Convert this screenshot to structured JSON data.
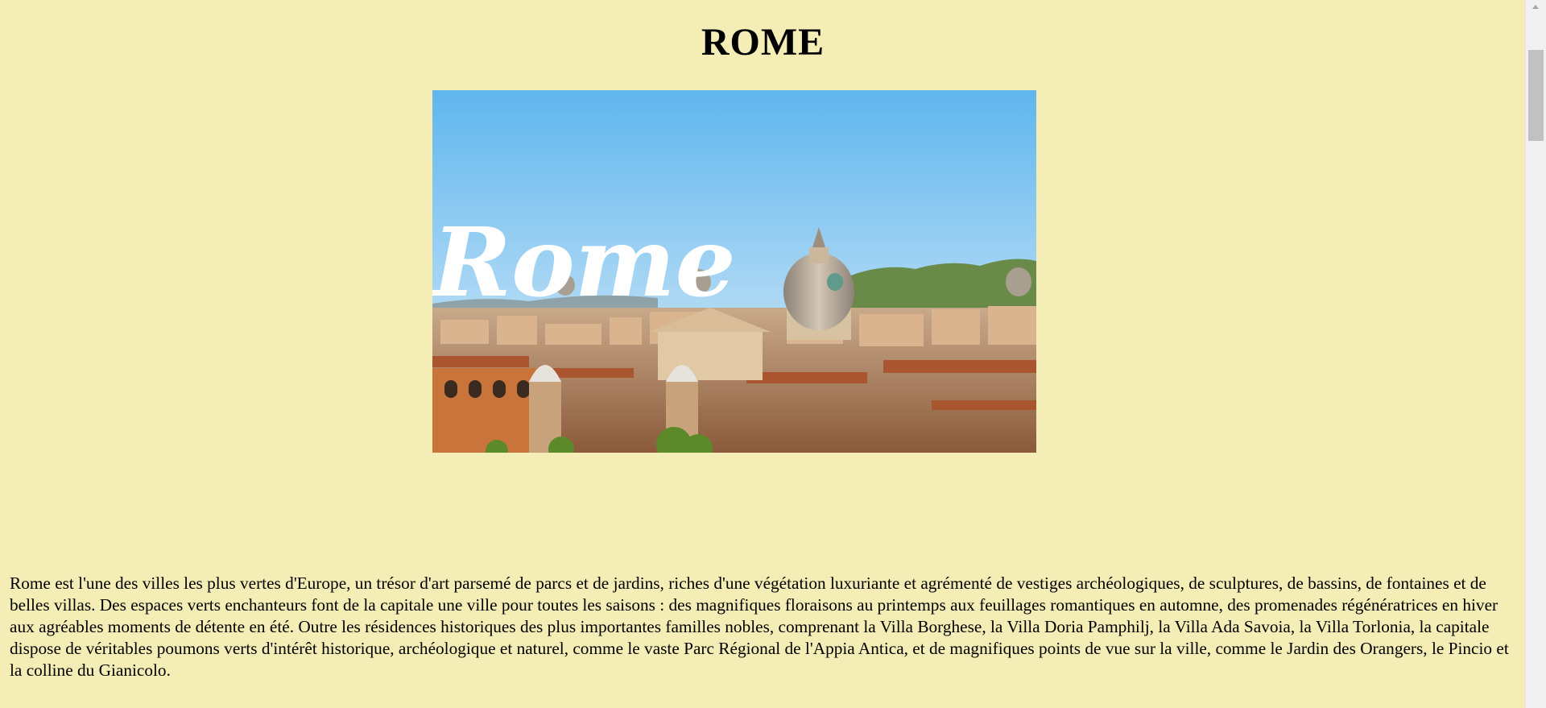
{
  "page": {
    "title": "ROME",
    "hero_overlay_text": "Rome",
    "intro": "Rome est l'une des villes les plus vertes d'Europe, un trésor d'art parsemé de parcs et de jardins, riches d'une végétation luxuriante et agrémenté de vestiges archéologiques, de sculptures, de bassins, de fontaines et de belles villas. Des espaces verts enchanteurs font de la capitale une ville pour toutes les saisons : des magnifiques floraisons au printemps aux feuillages romantiques en automne, des promenades régénératrices en hiver aux agréables moments de détente en été. Outre les résidences historiques des plus importantes familles nobles, comprenant la Villa Borghese, la Villa Doria Pamphilj, la Villa Ada Savoia, la Villa Torlonia, la capitale dispose de véritables poumons verts d'intérêt historique, archéologique et naturel, comme le vaste Parc Régional de l'Appia Antica, et de magnifiques points de vue sur la ville, comme le Jardin des Orangers, le Pincio et la colline du Gianicolo."
  },
  "colors": {
    "background": "#f5edb6",
    "sky_top": "#5fb6ee",
    "sky_bottom": "#bfe2f7",
    "roof": "#c9845a",
    "dome": "#b9aa95",
    "overlay_text": "#ffffff"
  },
  "scrollbar": {
    "position_fraction": 0.0
  }
}
